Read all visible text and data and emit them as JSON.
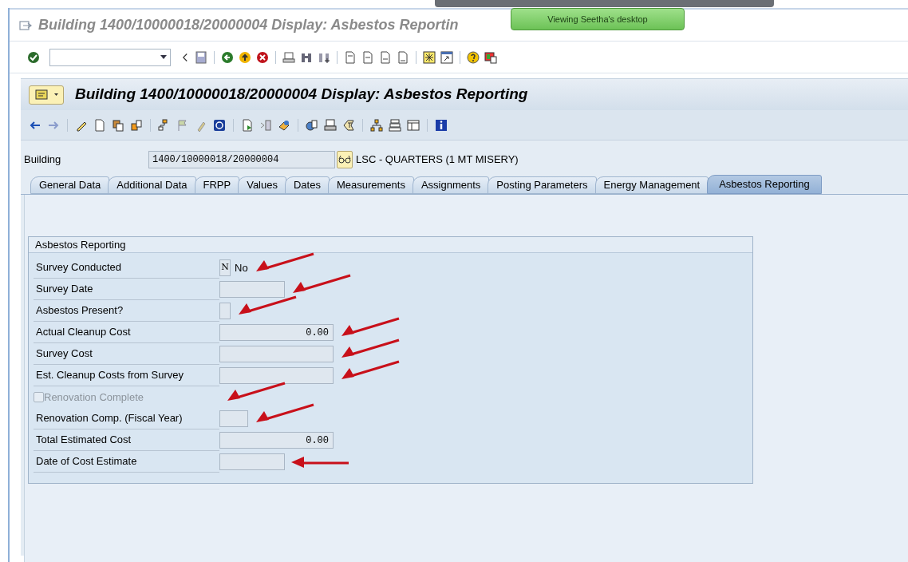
{
  "window": {
    "title": "Building 1400/10000018/20000004 Display: Asbestos Reportin"
  },
  "notification": "Viewing Seetha's desktop",
  "screen": {
    "title": "Building 1400/10000018/20000004 Display: Asbestos Reporting"
  },
  "header": {
    "label": "Building",
    "value": "1400/10000018/20000004",
    "description": "LSC - QUARTERS (1 MT MISERY)"
  },
  "tabs": [
    {
      "label": "General Data",
      "selected": false
    },
    {
      "label": "Additional Data",
      "selected": false
    },
    {
      "label": "FRPP",
      "selected": false
    },
    {
      "label": "Values",
      "selected": false
    },
    {
      "label": "Dates",
      "selected": false
    },
    {
      "label": "Measurements",
      "selected": false
    },
    {
      "label": "Assignments",
      "selected": false
    },
    {
      "label": "Posting Parameters",
      "selected": false
    },
    {
      "label": "Energy Management",
      "selected": false
    },
    {
      "label": "Asbestos Reporting",
      "selected": true
    }
  ],
  "group": {
    "title": "Asbestos Reporting",
    "rows": [
      {
        "kind": "code",
        "label": "Survey Conducted",
        "value": "N",
        "description": "No",
        "arrow": true,
        "arrow_flat": false
      },
      {
        "kind": "date",
        "label": "Survey Date",
        "arrow": true,
        "arrow_flat": false
      },
      {
        "kind": "flag",
        "label": "Asbestos Present?",
        "arrow": true,
        "arrow_flat": false
      },
      {
        "kind": "amount",
        "label": "Actual Cleanup Cost",
        "value": "0.00",
        "arrow": true,
        "arrow_flat": false
      },
      {
        "kind": "amount",
        "label": "Survey Cost",
        "arrow": true,
        "arrow_flat": false
      },
      {
        "kind": "amount",
        "label": "Est. Cleanup Costs from Survey",
        "arrow": true,
        "arrow_flat": false
      },
      {
        "kind": "checkbox",
        "label": "Renovation Complete",
        "checked": false,
        "disabled": true,
        "arrow": true,
        "arrow_flat": false
      },
      {
        "kind": "year",
        "label": "Renovation Comp. (Fiscal Year)",
        "arrow": true,
        "arrow_flat": false
      },
      {
        "kind": "amount",
        "label": "Total Estimated Cost",
        "value": "0.00",
        "arrow": false
      },
      {
        "kind": "date",
        "label": "Date of Cost Estimate",
        "arrow": true,
        "arrow_flat": true
      }
    ]
  }
}
